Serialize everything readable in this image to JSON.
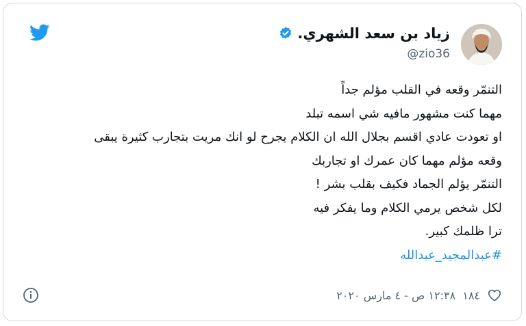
{
  "author": {
    "display_name": "زياد بن سعد الشهري.",
    "handle": "@zio36",
    "verified": true
  },
  "tweet": {
    "lines": [
      "التنمّر وقعه في القلب مؤلم جداً",
      "مهما كنت مشهور مافيه شي اسمه تبلد",
      "او تعودت عادي اقسم بجلال الله ان الكلام يجرح لو انك مريت بتجارب كثيرة يبقى",
      "وقعه مؤلم مهما كان عمرك او تجاربك",
      "التنمّر يؤلم الجماد فكيف بقلب بشر !",
      "لكل شخص يرمي الكلام وما يفكر فيه",
      "ترا ظلمك كبير."
    ],
    "hashtag": "#عبدالمجيد_عبدالله"
  },
  "footer": {
    "like_count": "١٨٤",
    "timestamp": "١٢:٣٨ ص - ٤ مارس ٢٠٢٠"
  },
  "icons": {
    "logo": "twitter-bird-icon",
    "verified": "verified-badge-icon",
    "like": "heart-icon",
    "info": "info-icon"
  },
  "colors": {
    "twitter_blue": "#1d9bf0",
    "hashtag": "#1b95e0",
    "secondary_text": "#536471",
    "primary_text": "#0f1419",
    "border": "#cfd9de"
  }
}
